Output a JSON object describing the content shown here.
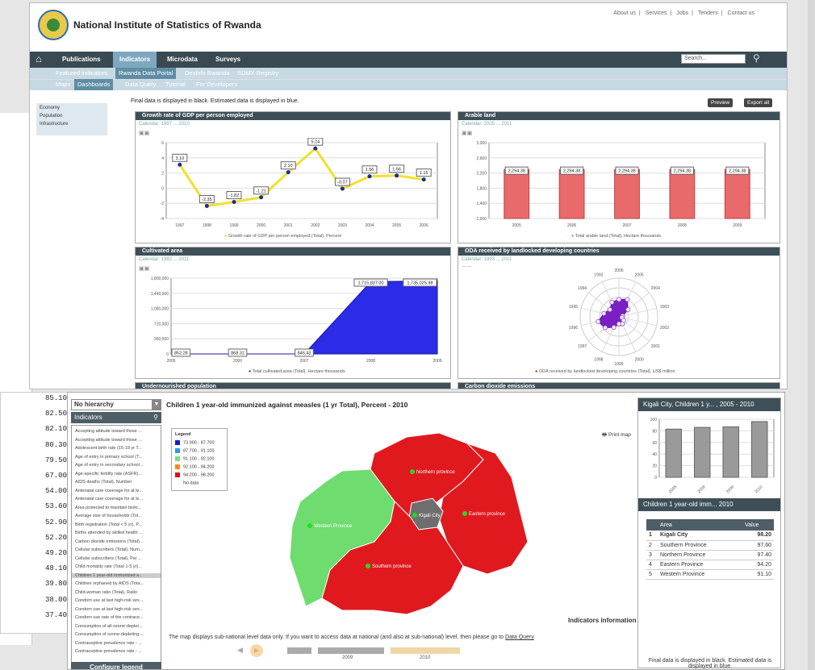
{
  "site": {
    "title": "National Institute of Statistics of Rwanda",
    "top_links": [
      "About us",
      "Services",
      "Jobs",
      "Tenders",
      "Contact us"
    ]
  },
  "nav": {
    "items": [
      "Publications",
      "Indicators",
      "Microdata",
      "Surveys"
    ],
    "search_placeholder": "Search..."
  },
  "subnav1": [
    "Featured indicators",
    "Rwanda Data Portal",
    "DevInfo Rwanda",
    "SDMX Registry"
  ],
  "subnav2": [
    "Maps",
    "Dashboards",
    "Data Query",
    "Tutorial",
    "For Developers"
  ],
  "left_menu": [
    "Economy",
    "Population",
    "Infrastructure"
  ],
  "dashboard": {
    "note": "Final data is displayed in black. Estimated data is displayed in blue.",
    "preview": "Preview",
    "export": "Export all"
  },
  "background_values": [
    "85.10",
    "82.50",
    "82.10",
    "80.30",
    "79.50",
    "67.00",
    "54.00",
    "53.60",
    "52.90",
    "52.20",
    "49.20",
    "48.10",
    "39.80",
    "38.00",
    "37.40"
  ],
  "panels": {
    "gdp": {
      "title": "Growth rate of GDP per person employed",
      "calendar": "Calendar: 1997 ... 2010",
      "legend": "Growth rate of GDP per person employed (Total), Percent"
    },
    "arable": {
      "title": "Arable land",
      "calendar": "Calendar: 2005 ... 2011",
      "legend": "Total arable land (Total), Hectare thousands"
    },
    "cultivated": {
      "title": "Cultivated area",
      "calendar": "Calendar: 1982 ... 2011",
      "legend": "Total cultivated area (Total), Hectare thousands"
    },
    "oda": {
      "title": "ODA received by landlocked developing countries",
      "calendar": "Calendar: 1993 ... 2011",
      "legend": "ODA received by landlocked developing countries (Total), US$ million"
    },
    "undernourished": {
      "title": "Undernourished population"
    },
    "co2": {
      "title": "Carbon dioxide emissions"
    }
  },
  "chart_data": [
    {
      "type": "line",
      "categories": [
        "1997",
        "1998",
        "1999",
        "2000",
        "2001",
        "2002",
        "2003",
        "2004",
        "2005",
        "2006"
      ],
      "values": [
        3.1,
        -2.35,
        -1.82,
        -1.21,
        2.1,
        5.24,
        -0.07,
        1.56,
        1.66,
        1.15
      ],
      "ylim": [
        -4,
        6
      ],
      "yticks": [
        "6",
        "4",
        "2",
        "0",
        "-2",
        "-4"
      ],
      "color": "#f2e02a"
    },
    {
      "type": "bar",
      "categories": [
        "2005",
        "2006",
        "2007",
        "2008",
        "2009"
      ],
      "values": [
        2294.38,
        2294.38,
        2294.38,
        2294.38,
        2294.38
      ],
      "value_labels": [
        "2,294.38",
        "2,294.38",
        "2,294.38",
        "2,294.38",
        "2,294.38"
      ],
      "ylim": [
        1000,
        3000
      ],
      "yticks": [
        "3,000",
        "2,600",
        "2,200",
        "1,800",
        "1,400",
        "1,000"
      ],
      "color": "#e86a6a"
    },
    {
      "type": "area",
      "categories": [
        "2005",
        "2006",
        "2007",
        "2008",
        "2009"
      ],
      "values": [
        852.28,
        868.31,
        846.43,
        1715837.0,
        1735025.98
      ],
      "value_labels": [
        "852.28",
        "868.31",
        "846.43",
        "1,715,837.00",
        "1,735,025.98"
      ],
      "ylim": [
        0,
        1800000
      ],
      "yticks": [
        "1,800,000",
        "1,440,000",
        "1,080,000",
        "720,000",
        "360,000",
        "0"
      ],
      "color": "#2b2be8"
    },
    {
      "type": "area",
      "categories": [
        "2006",
        "2005",
        "2004",
        "2003",
        "2002",
        "2001",
        "2000",
        "1999",
        "1998",
        "1997",
        "1996",
        "1995",
        "1994",
        "1993"
      ],
      "color": "#7a1fc4"
    }
  ],
  "map": {
    "hierarchy": "No hierarchy",
    "indicators_title": "Indicators",
    "indicator_list": [
      "Accepting attitude toward those ...",
      "Accepting attitude toward those ...",
      "Adolescent birth rate (15-19 yr T...",
      "Age of entry in primary school (T...",
      "Age of entry in secondary school...",
      "Age-specific fertility rate (ASFR)...",
      "AIDS deaths (Total), Number",
      "Antenatal care coverage for at le...",
      "Antenatal care coverage for at le...",
      "Area protected to maintain biolo...",
      "Average size of households (Tot...",
      "Birth registration (Total < 5 yr), P...",
      "Births attended by skilled health ...",
      "Carbon dioxide emissions (Total)...",
      "Cellular subscribers (Total), Num...",
      "Cellular subscribers (Total), Per ...",
      "Child mortality rate (Total 1-5 yr)...",
      "Children 1 year-old immunized a...",
      "Children orphaned by AIDS (Tota...",
      "Child-woman ratio (Total), Ratio",
      "Condom use at last high-risk sex...",
      "Condom use at last high-risk sex...",
      "Condom use rate of the contrace...",
      "Consumption of all ozone-deplet...",
      "Consumption of ozone-depleting ...",
      "Contraceptive prevalence rate - ...",
      "Contraceptive prevalence rate - ..."
    ],
    "configure_legend": "Configure legend",
    "title": "Children 1 year-old immunized against measles (1 yr Total), Percent - 2010",
    "legend_title": "Legend",
    "legend_items": [
      {
        "label": "73.900 - 87.700",
        "color": "#1020c8"
      },
      {
        "label": "87.700 - 91.100",
        "color": "#25a0e0"
      },
      {
        "label": "91.100 - 92.100",
        "color": "#7ae07a"
      },
      {
        "label": "92.100 - 94.200",
        "color": "#f08a20"
      },
      {
        "label": "94.200 - 98.200",
        "color": "#e01010"
      },
      {
        "label": "No data",
        "color": "#ffffff"
      }
    ],
    "print_map": "Print map",
    "provinces": [
      "Northern province",
      "Eastern province",
      "Kigali City",
      "Western Province",
      "Southern province"
    ],
    "indicators_information": "Indicators information",
    "note": "The map displays sub-national level data only. If you want to access data at national (and also at sub-national) level, then please go to",
    "note_link": "Data Query",
    "timeline_years": [
      "2009",
      "2010"
    ]
  },
  "right": {
    "chart_title": "Kigali City, Children 1 y... , 2005 - 2010",
    "mini_chart": {
      "type": "bar",
      "categories": [
        "2005",
        "2008",
        "2009",
        "2010"
      ],
      "values": [
        83,
        86,
        87,
        96
      ],
      "ylim": [
        0,
        100
      ],
      "yticks": [
        "100",
        "80",
        "60",
        "40",
        "20",
        "0"
      ]
    },
    "table_title": "Children 1 year-old imm... 2010",
    "table_headers": [
      "Area",
      "Value"
    ],
    "rows": [
      {
        "n": "1",
        "area": "Kigali City",
        "value": "98.20"
      },
      {
        "n": "2",
        "area": "Southern Province",
        "value": "97.60"
      },
      {
        "n": "3",
        "area": "Northern Province",
        "value": "97.40"
      },
      {
        "n": "4",
        "area": "Eastern Province",
        "value": "94.20"
      },
      {
        "n": "5",
        "area": "Western Province",
        "value": "91.10"
      }
    ],
    "note": "Final data is displayed in black. Estimated data is displayed in blue."
  }
}
